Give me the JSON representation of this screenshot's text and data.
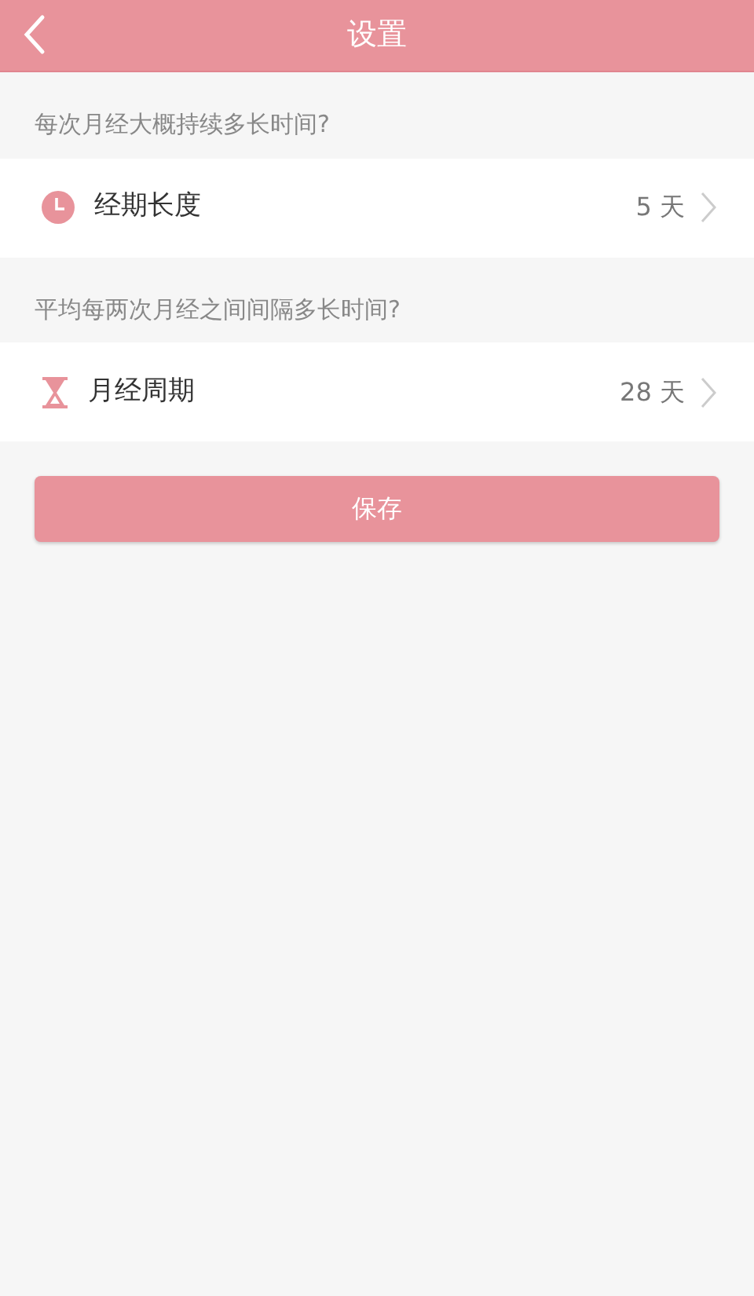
{
  "header": {
    "title": "设置"
  },
  "sections": [
    {
      "question": "每次月经大概持续多长时间?",
      "kind": "duration",
      "label": "经期长度",
      "value": "5 天"
    },
    {
      "question": "平均每两次月经之间间隔多长时间?",
      "kind": "cycle",
      "label": "月经周期",
      "value": "28 天"
    }
  ],
  "save_button": "保存"
}
